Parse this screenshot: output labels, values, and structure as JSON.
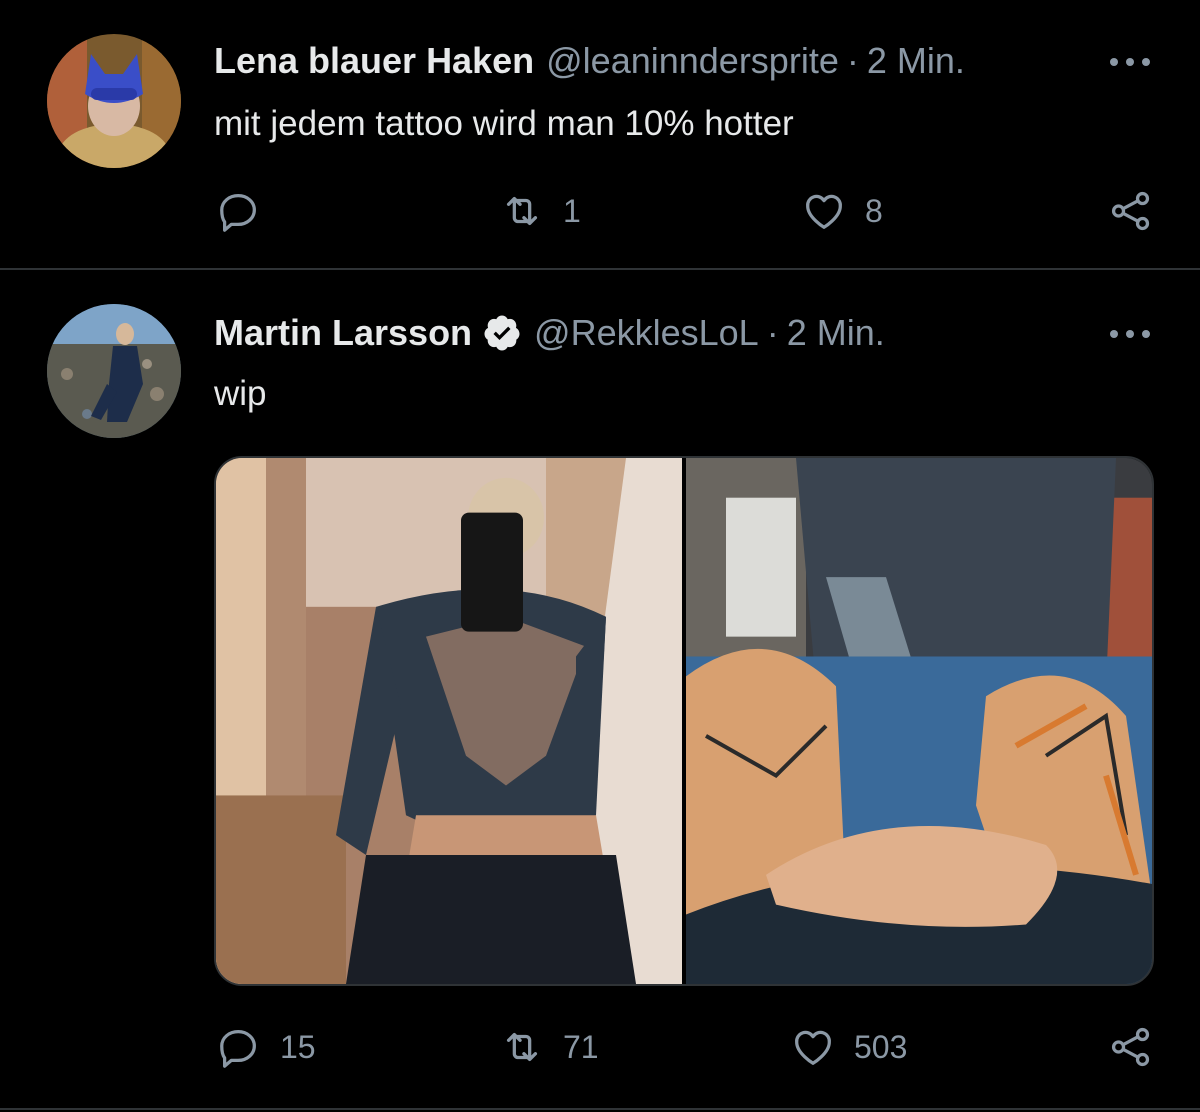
{
  "tweets": [
    {
      "author": {
        "display_name": "Lena blauer Haken",
        "handle": "@leaninndersprite",
        "verified": false,
        "avatar": "avatar-masked-cat"
      },
      "separator": "·",
      "time": "2 Min.",
      "text": "mit jedem tattoo wird man 10% hotter",
      "actions": {
        "reply": "",
        "retweet": "1",
        "like": "8"
      }
    },
    {
      "author": {
        "display_name": "Martin Larsson",
        "handle": "@RekklesLoL",
        "verified": true,
        "avatar": "avatar-man-sitting"
      },
      "separator": "·",
      "time": "2 Min.",
      "text": "wip",
      "media": [
        "mirror-selfie-chest-tattoo",
        "leg-tattoo-in-progress"
      ],
      "actions": {
        "reply": "15",
        "retweet": "71",
        "like": "503"
      }
    }
  ],
  "colors": {
    "background": "#000000",
    "text": "#e7e9ea",
    "secondary": "#8b98a5",
    "divider": "#2f3336"
  }
}
